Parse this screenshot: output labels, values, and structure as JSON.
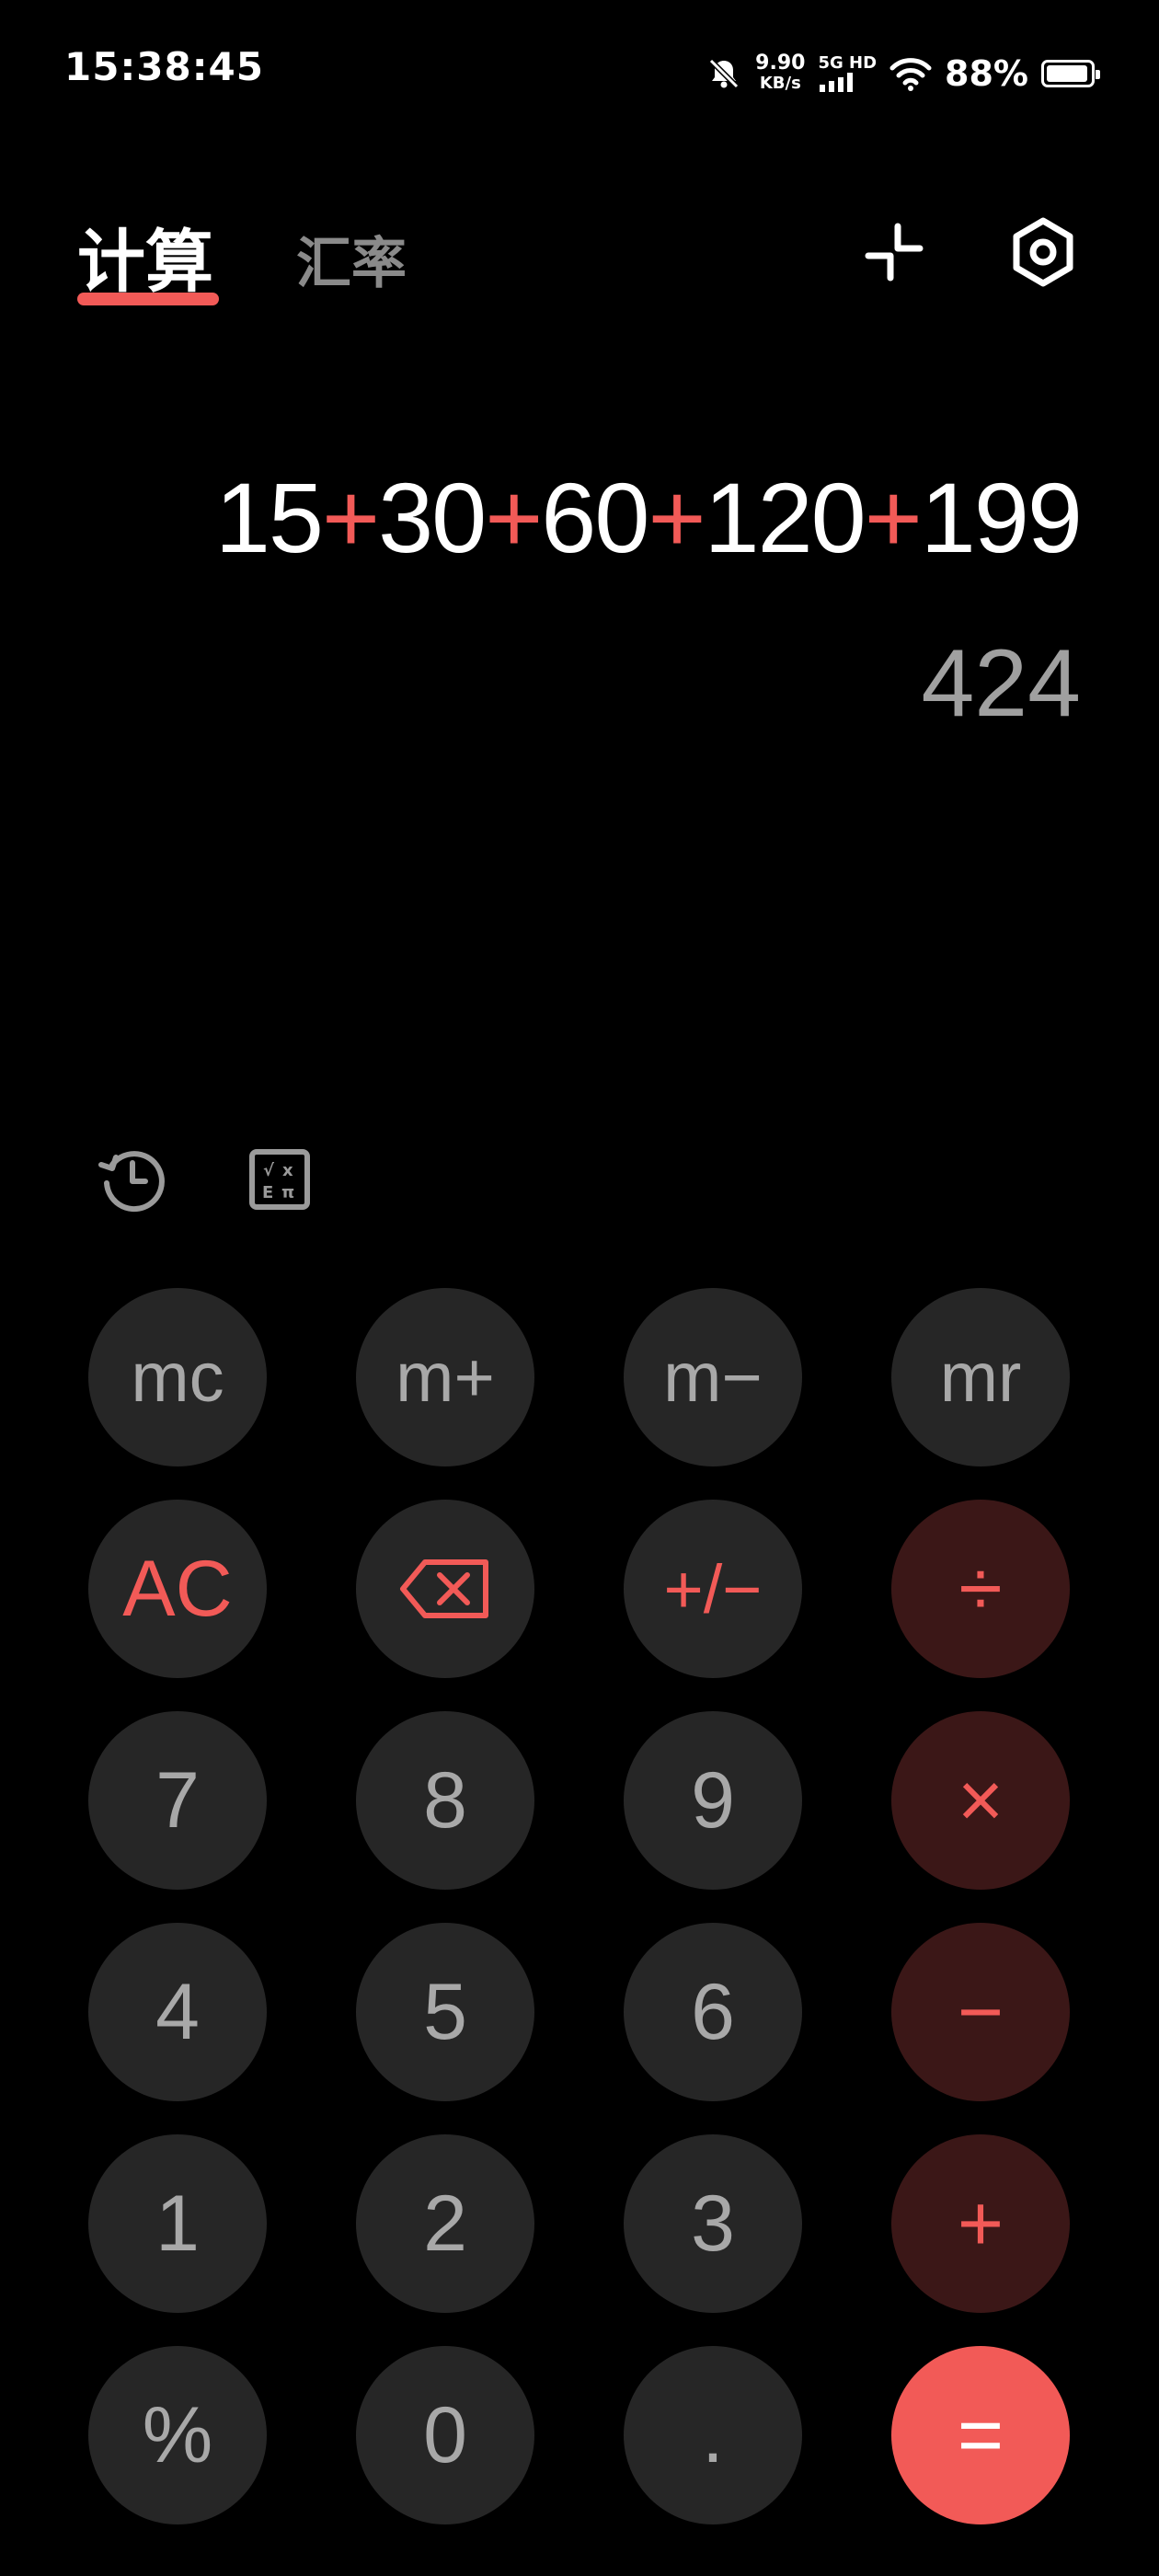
{
  "status_bar": {
    "time": "15:38:45",
    "net_speed_value": "9.90",
    "net_speed_unit": "KB/s",
    "network_type": "5G HD",
    "battery_percent": "88%",
    "battery_level": 0.88
  },
  "header": {
    "tabs": [
      {
        "label": "计算",
        "active": true
      },
      {
        "label": "汇率",
        "active": false
      }
    ]
  },
  "display": {
    "expression_parts": [
      "15",
      "+",
      "30",
      "+",
      "60",
      "+",
      "120",
      "+",
      "199"
    ],
    "result": "424"
  },
  "keypad": {
    "rows": [
      [
        {
          "label": "mc"
        },
        {
          "label": "m+"
        },
        {
          "label": "m−"
        },
        {
          "label": "mr"
        }
      ],
      [
        {
          "label": "AC"
        },
        {
          "label": "backspace",
          "icon": "backspace-icon"
        },
        {
          "label": "+/−"
        },
        {
          "label": "÷"
        }
      ],
      [
        {
          "label": "7"
        },
        {
          "label": "8"
        },
        {
          "label": "9"
        },
        {
          "label": "×"
        }
      ],
      [
        {
          "label": "4"
        },
        {
          "label": "5"
        },
        {
          "label": "6"
        },
        {
          "label": "−"
        }
      ],
      [
        {
          "label": "1"
        },
        {
          "label": "2"
        },
        {
          "label": "3"
        },
        {
          "label": "+"
        }
      ],
      [
        {
          "label": "%"
        },
        {
          "label": "0"
        },
        {
          "label": "."
        },
        {
          "label": "="
        }
      ]
    ]
  },
  "colors": {
    "accent": "#f25a57",
    "key_bg": "#262626",
    "operator_bg": "#3b1717",
    "background": "#000000"
  },
  "icons": [
    "mute-bell-icon",
    "signal-icon",
    "wifi-icon",
    "battery-icon",
    "compact-mode-icon",
    "settings-icon",
    "history-icon",
    "scientific-icon",
    "backspace-icon"
  ]
}
